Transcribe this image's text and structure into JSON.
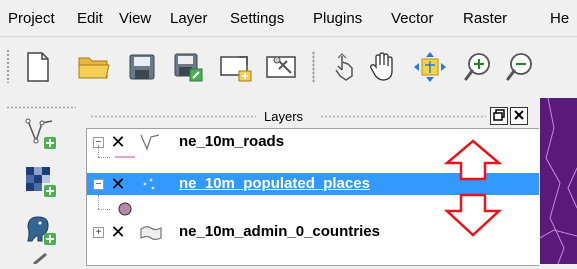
{
  "menu": {
    "items": [
      "Project",
      "Edit",
      "View",
      "Layer",
      "Settings",
      "Plugins",
      "Vector",
      "Raster",
      "He"
    ],
    "mnemonics": [
      "j",
      "E",
      "V",
      "L",
      "S",
      "P",
      "o",
      "R",
      "H"
    ]
  },
  "toolbar": {
    "buttons": [
      "new-project",
      "open-project",
      "save-project",
      "save-project-as",
      "new-print-composer",
      "composer-manager",
      "touch-zoom-pan",
      "pan-map",
      "pan-to-selection",
      "zoom-in",
      "zoom-out"
    ]
  },
  "left_toolbar": {
    "buttons": [
      "add-vector-layer",
      "add-raster-layer",
      "add-postgis-layer",
      "add-more"
    ]
  },
  "panel": {
    "title": "Layers"
  },
  "layers": [
    {
      "name": "ne_10m_roads",
      "checked": true,
      "expanded": true,
      "selected": false,
      "geometry": "line"
    },
    {
      "name": "ne_10m_populated_places",
      "checked": true,
      "expanded": true,
      "selected": true,
      "geometry": "point"
    },
    {
      "name": "ne_10m_admin_0_countries",
      "checked": true,
      "expanded": false,
      "selected": false,
      "geometry": "polygon"
    }
  ],
  "colors": {
    "selection": "#3399ff",
    "arrow": "#e8141c",
    "map": "#5a1a7a",
    "point_symbol": "#b889a8",
    "road_symbol": "#e8a0c8"
  }
}
